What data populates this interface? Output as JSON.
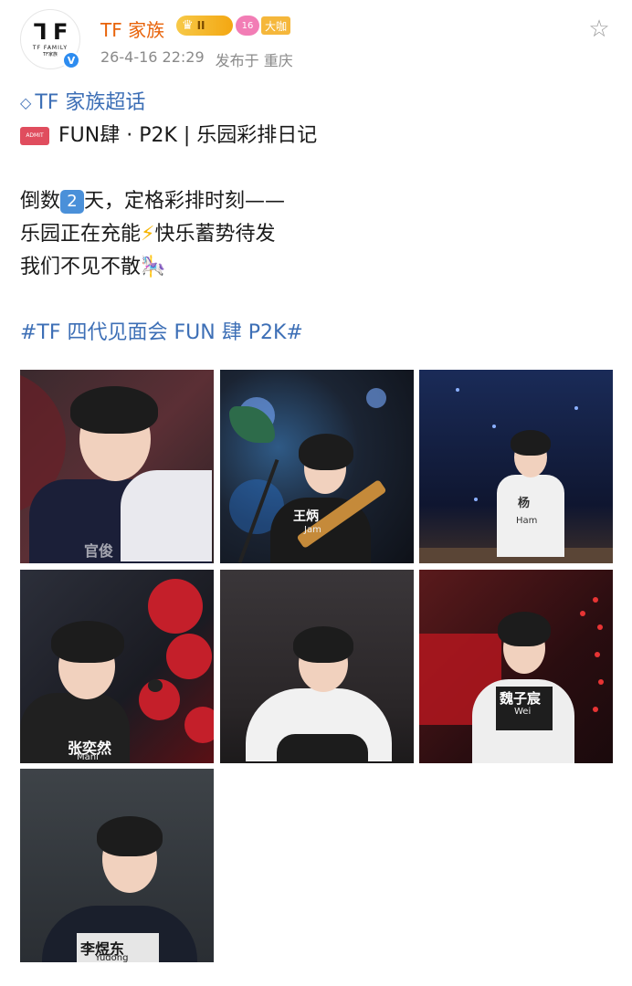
{
  "account": {
    "avatar_mark": "ᒣ F",
    "avatar_label": "TF FAMILY",
    "avatar_sub": "TF家族",
    "verified_icon": "verified-badge-icon",
    "name": "TF 家族",
    "crown_badge_label": "II",
    "level_badge_label": "16",
    "big_badge_label": "大咖"
  },
  "post": {
    "date": "26-4-16 22:29",
    "source": "发布于 重庆",
    "topic": "TF 家族超话",
    "title_line": "FUN肆 · P2K | 乐园彩排日记",
    "ticket_text": "ADMIT ONE",
    "line1_pre": "倒数",
    "line1_num": "2",
    "line1_post": "天，定格彩排时刻——",
    "line2_pre": "乐园正在充能",
    "line2_bolt": "⚡",
    "line2_post": "快乐蓄势待发",
    "line3_text": "我们不见不散",
    "line3_icon": "🎠",
    "hashtag": "#TF 四代见面会 FUN 肆 P2K#"
  },
  "photos": [
    {
      "tag": "官俊",
      "sub": ""
    },
    {
      "tag": "王炳",
      "sub": "Jam"
    },
    {
      "tag": "杨",
      "sub": "Ham"
    },
    {
      "tag": "张奕然",
      "sub": "Mani"
    },
    {
      "tag": "",
      "sub": ""
    },
    {
      "tag": "魏子宸",
      "sub": "Wei"
    },
    {
      "tag": "李煜东",
      "sub": "Yudong"
    }
  ],
  "icons": {
    "star": "star-outline-icon",
    "diamond": "diamond-icon"
  }
}
